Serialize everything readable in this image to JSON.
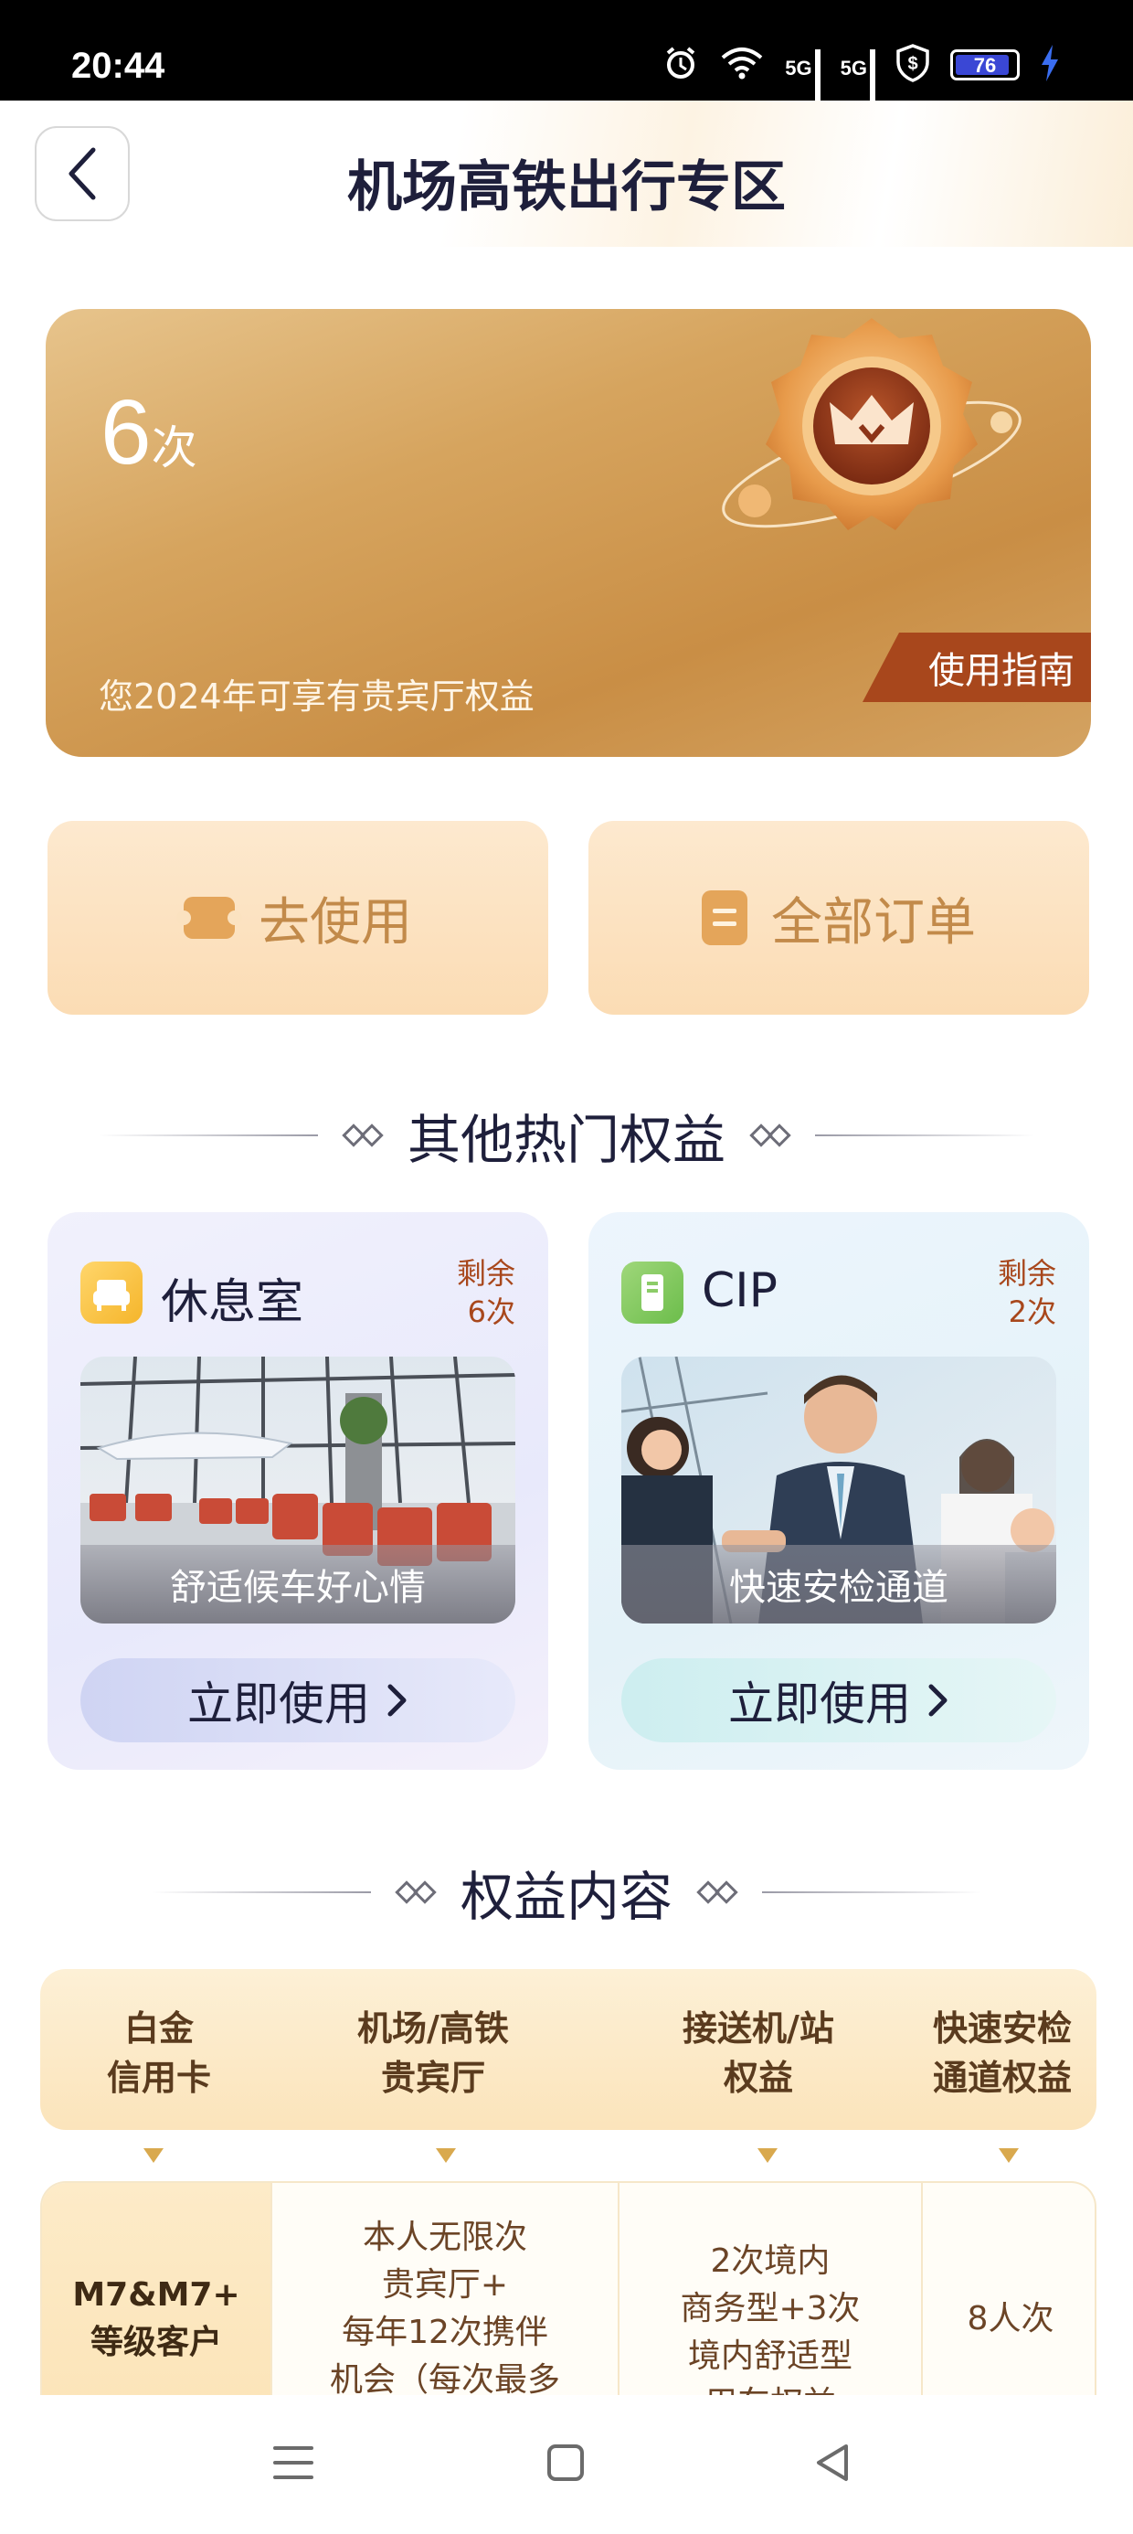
{
  "status_bar": {
    "time": "20:44",
    "network_1": "5G",
    "network_2": "5G",
    "battery": "76"
  },
  "header": {
    "title": "机场高铁出行专区"
  },
  "gold_card": {
    "count": "6",
    "count_unit": "次",
    "subtitle": "您2024年可享有贵宾厅权益",
    "guide_label": "使用指南"
  },
  "actions": {
    "use_label": "去使用",
    "orders_label": "全部订单"
  },
  "section_hot": {
    "title": "其他热门权益"
  },
  "benefits": [
    {
      "name": "休息室",
      "remain_label": "剩余",
      "remain_count": "6次",
      "caption": "舒适候车好心情",
      "button": "立即使用"
    },
    {
      "name": "CIP",
      "remain_label": "剩余",
      "remain_count": "2次",
      "caption": "快速安检通道",
      "button": "立即使用"
    }
  ],
  "section_content": {
    "title": "权益内容"
  },
  "table": {
    "headers": [
      [
        "白金",
        "信用卡"
      ],
      [
        "机场/高铁",
        "贵宾厅"
      ],
      [
        "接送机/站",
        "权益"
      ],
      [
        "快速安检",
        "通道权益"
      ]
    ],
    "row": {
      "col1": [
        "M7&M7+",
        "等级客户"
      ],
      "col2": [
        "本人无限次",
        "贵宾厅+",
        "每年12次携伴",
        "机会（每次最多"
      ],
      "col3": [
        "2次境内",
        "商务型+3次",
        "境内舒适型",
        "用车权益"
      ],
      "col4": [
        "8人次"
      ]
    }
  },
  "colors": {
    "accent_gold": "#c98e45",
    "guide_red": "#a8471c",
    "title_navy": "#1e1f3b"
  }
}
